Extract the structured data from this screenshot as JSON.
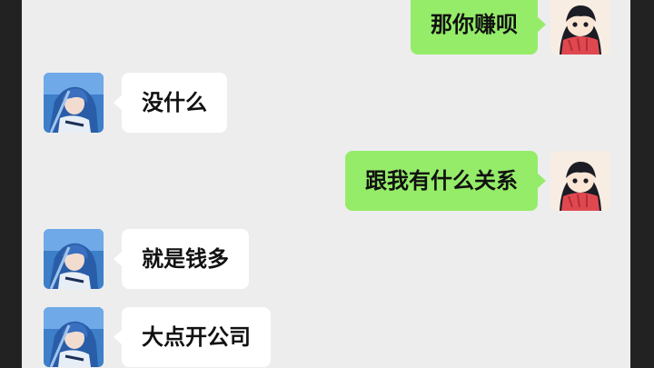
{
  "colors": {
    "chat_background": "#ededed",
    "outgoing_bubble": "#95ec69",
    "incoming_bubble": "#ffffff",
    "frame": "#222222"
  },
  "messages": [
    {
      "side": "right",
      "sender": "self",
      "avatar": "girl-red-scarf-avatar",
      "text": "那你赚呗"
    },
    {
      "side": "left",
      "sender": "contact",
      "avatar": "blue-hair-character-avatar",
      "text": "没什么"
    },
    {
      "side": "right",
      "sender": "self",
      "avatar": "girl-red-scarf-avatar",
      "text": "跟我有什么关系"
    },
    {
      "side": "left",
      "sender": "contact",
      "avatar": "blue-hair-character-avatar",
      "text": "就是钱多"
    },
    {
      "side": "left",
      "sender": "contact",
      "avatar": "blue-hair-character-avatar",
      "text": "大点开公司"
    }
  ]
}
